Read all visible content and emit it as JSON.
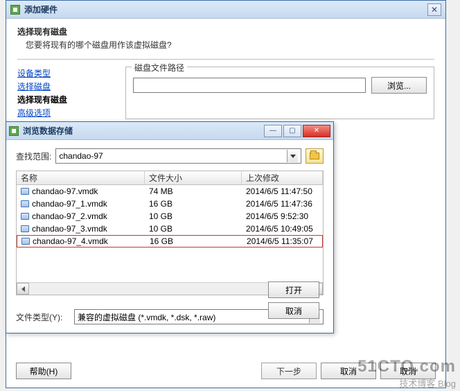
{
  "parent": {
    "title": "添加硬件",
    "section_title": "选择现有磁盘",
    "section_sub": "您要将现有的哪个磁盘用作该虚拟磁盘?",
    "nav": {
      "device_type": "设备类型",
      "select_disk": "选择磁盘",
      "current": "选择现有磁盘",
      "adv_truncated": "高级选项"
    },
    "fieldset_legend": "磁盘文件路径",
    "path_value": "",
    "browse_btn": "浏览...",
    "footer": {
      "help": "帮助(H)",
      "back": "下一步",
      "next": "取消",
      "cancel": "取消"
    }
  },
  "browse": {
    "title": "浏览数据存储",
    "scope_label": "查找范围:",
    "scope_value": "chandao-97",
    "cols": {
      "name": "名称",
      "size": "文件大小",
      "date": "上次修改"
    },
    "rows": [
      {
        "name": "chandao-97.vmdk",
        "size": "74 MB",
        "date": "2014/6/5 11:47:50",
        "selected": false
      },
      {
        "name": "chandao-97_1.vmdk",
        "size": "16 GB",
        "date": "2014/6/5 11:47:36",
        "selected": false
      },
      {
        "name": "chandao-97_2.vmdk",
        "size": "10 GB",
        "date": "2014/6/5 9:52:30",
        "selected": false
      },
      {
        "name": "chandao-97_3.vmdk",
        "size": "10 GB",
        "date": "2014/6/5 10:49:05",
        "selected": false
      },
      {
        "name": "chandao-97_4.vmdk",
        "size": "16 GB",
        "date": "2014/6/5 11:35:07",
        "selected": true
      }
    ],
    "type_label": "文件类型(Y):",
    "type_value": "兼容的虚拟磁盘 (*.vmdk, *.dsk, *.raw)",
    "open_btn": "打开",
    "cancel_btn": "取消"
  },
  "watermark": {
    "big": "51CTO.com",
    "small": "技术博客 Blog"
  }
}
